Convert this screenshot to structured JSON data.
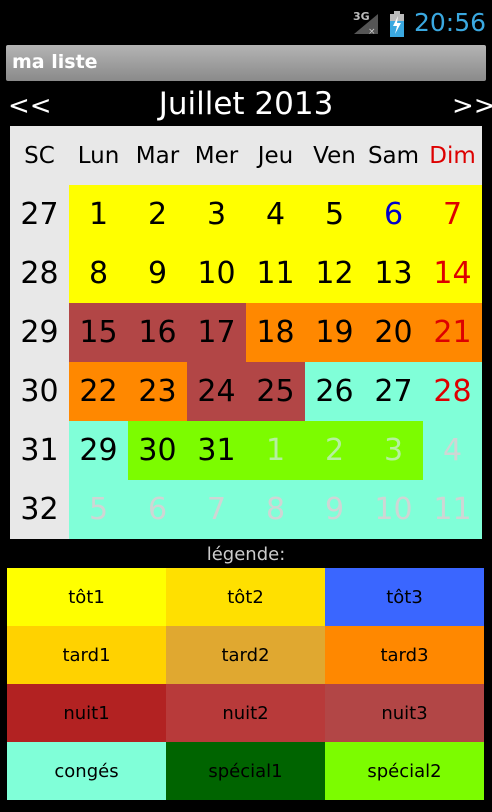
{
  "status_bar": {
    "network": "3G",
    "time": "20:56"
  },
  "title_bar": {
    "title": "ma liste"
  },
  "nav": {
    "prev_label": "<<",
    "month_label": "Juillet 2013",
    "next_label": ">>"
  },
  "calendar": {
    "headers": [
      "SC",
      "Lun",
      "Mar",
      "Mer",
      "Jeu",
      "Ven",
      "Sam",
      "Dim"
    ],
    "weeks": [
      {
        "week": "27",
        "days": [
          {
            "label": "1",
            "bg": "#ffff00",
            "fg": "#000000"
          },
          {
            "label": "2",
            "bg": "#ffff00",
            "fg": "#000000"
          },
          {
            "label": "3",
            "bg": "#ffff00",
            "fg": "#000000"
          },
          {
            "label": "4",
            "bg": "#ffff00",
            "fg": "#000000"
          },
          {
            "label": "5",
            "bg": "#ffff00",
            "fg": "#000000"
          },
          {
            "label": "6",
            "bg": "#ffff00",
            "fg": "#0000cc"
          },
          {
            "label": "7",
            "bg": "#ffff00",
            "fg": "#dd0000"
          }
        ]
      },
      {
        "week": "28",
        "days": [
          {
            "label": "8",
            "bg": "#ffff00",
            "fg": "#000000"
          },
          {
            "label": "9",
            "bg": "#ffff00",
            "fg": "#000000"
          },
          {
            "label": "10",
            "bg": "#ffff00",
            "fg": "#000000"
          },
          {
            "label": "11",
            "bg": "#ffff00",
            "fg": "#000000"
          },
          {
            "label": "12",
            "bg": "#ffff00",
            "fg": "#000000"
          },
          {
            "label": "13",
            "bg": "#ffff00",
            "fg": "#000000"
          },
          {
            "label": "14",
            "bg": "#ffff00",
            "fg": "#dd0000"
          }
        ]
      },
      {
        "week": "29",
        "days": [
          {
            "label": "15",
            "bg": "#b24646",
            "fg": "#000000"
          },
          {
            "label": "16",
            "bg": "#b24646",
            "fg": "#000000"
          },
          {
            "label": "17",
            "bg": "#b24646",
            "fg": "#000000"
          },
          {
            "label": "18",
            "bg": "#ff8800",
            "fg": "#000000"
          },
          {
            "label": "19",
            "bg": "#ff8800",
            "fg": "#000000"
          },
          {
            "label": "20",
            "bg": "#ff8800",
            "fg": "#000000"
          },
          {
            "label": "21",
            "bg": "#ff8800",
            "fg": "#dd0000"
          }
        ]
      },
      {
        "week": "30",
        "days": [
          {
            "label": "22",
            "bg": "#ff8800",
            "fg": "#000000"
          },
          {
            "label": "23",
            "bg": "#ff8800",
            "fg": "#000000"
          },
          {
            "label": "24",
            "bg": "#b24646",
            "fg": "#000000"
          },
          {
            "label": "25",
            "bg": "#b24646",
            "fg": "#000000"
          },
          {
            "label": "26",
            "bg": "#80ffd8",
            "fg": "#000000"
          },
          {
            "label": "27",
            "bg": "#80ffd8",
            "fg": "#000000"
          },
          {
            "label": "28",
            "bg": "#80ffd8",
            "fg": "#dd0000"
          }
        ]
      },
      {
        "week": "31",
        "days": [
          {
            "label": "29",
            "bg": "#80ffd8",
            "fg": "#000000"
          },
          {
            "label": "30",
            "bg": "#7cfc00",
            "fg": "#000000"
          },
          {
            "label": "31",
            "bg": "#7cfc00",
            "fg": "#000000"
          },
          {
            "label": "1",
            "bg": "#7cfc00",
            "fg": "#b6f0a0"
          },
          {
            "label": "2",
            "bg": "#7cfc00",
            "fg": "#b6f0a0"
          },
          {
            "label": "3",
            "bg": "#7cfc00",
            "fg": "#b6f0a0"
          },
          {
            "label": "4",
            "bg": "#80ffd8",
            "fg": "#cfd6d4"
          }
        ]
      },
      {
        "week": "32",
        "days": [
          {
            "label": "5",
            "bg": "#80ffd8",
            "fg": "#cfd6d4"
          },
          {
            "label": "6",
            "bg": "#80ffd8",
            "fg": "#cfd6d4"
          },
          {
            "label": "7",
            "bg": "#80ffd8",
            "fg": "#cfd6d4"
          },
          {
            "label": "8",
            "bg": "#80ffd8",
            "fg": "#cfd6d4"
          },
          {
            "label": "9",
            "bg": "#80ffd8",
            "fg": "#cfd6d4"
          },
          {
            "label": "10",
            "bg": "#80ffd8",
            "fg": "#cfd6d4"
          },
          {
            "label": "11",
            "bg": "#80ffd8",
            "fg": "#cfd6d4"
          }
        ]
      }
    ],
    "header_bg": "#e8e8e8",
    "dim_color": "#dd0000"
  },
  "legend": {
    "title": "légende:",
    "items": [
      {
        "label": "tôt1",
        "bg": "#ffff00"
      },
      {
        "label": "tôt2",
        "bg": "#ffe000"
      },
      {
        "label": "tôt3",
        "bg": "#3a66ff"
      },
      {
        "label": "tard1",
        "bg": "#ffd200"
      },
      {
        "label": "tard2",
        "bg": "#e0a830"
      },
      {
        "label": "tard3",
        "bg": "#ff8800"
      },
      {
        "label": "nuit1",
        "bg": "#b22222"
      },
      {
        "label": "nuit2",
        "bg": "#b83a3a"
      },
      {
        "label": "nuit3",
        "bg": "#b24646"
      },
      {
        "label": "congés",
        "bg": "#80ffd8"
      },
      {
        "label": "spécial1",
        "bg": "#006400"
      },
      {
        "label": "spécial2",
        "bg": "#7cfc00"
      }
    ]
  }
}
